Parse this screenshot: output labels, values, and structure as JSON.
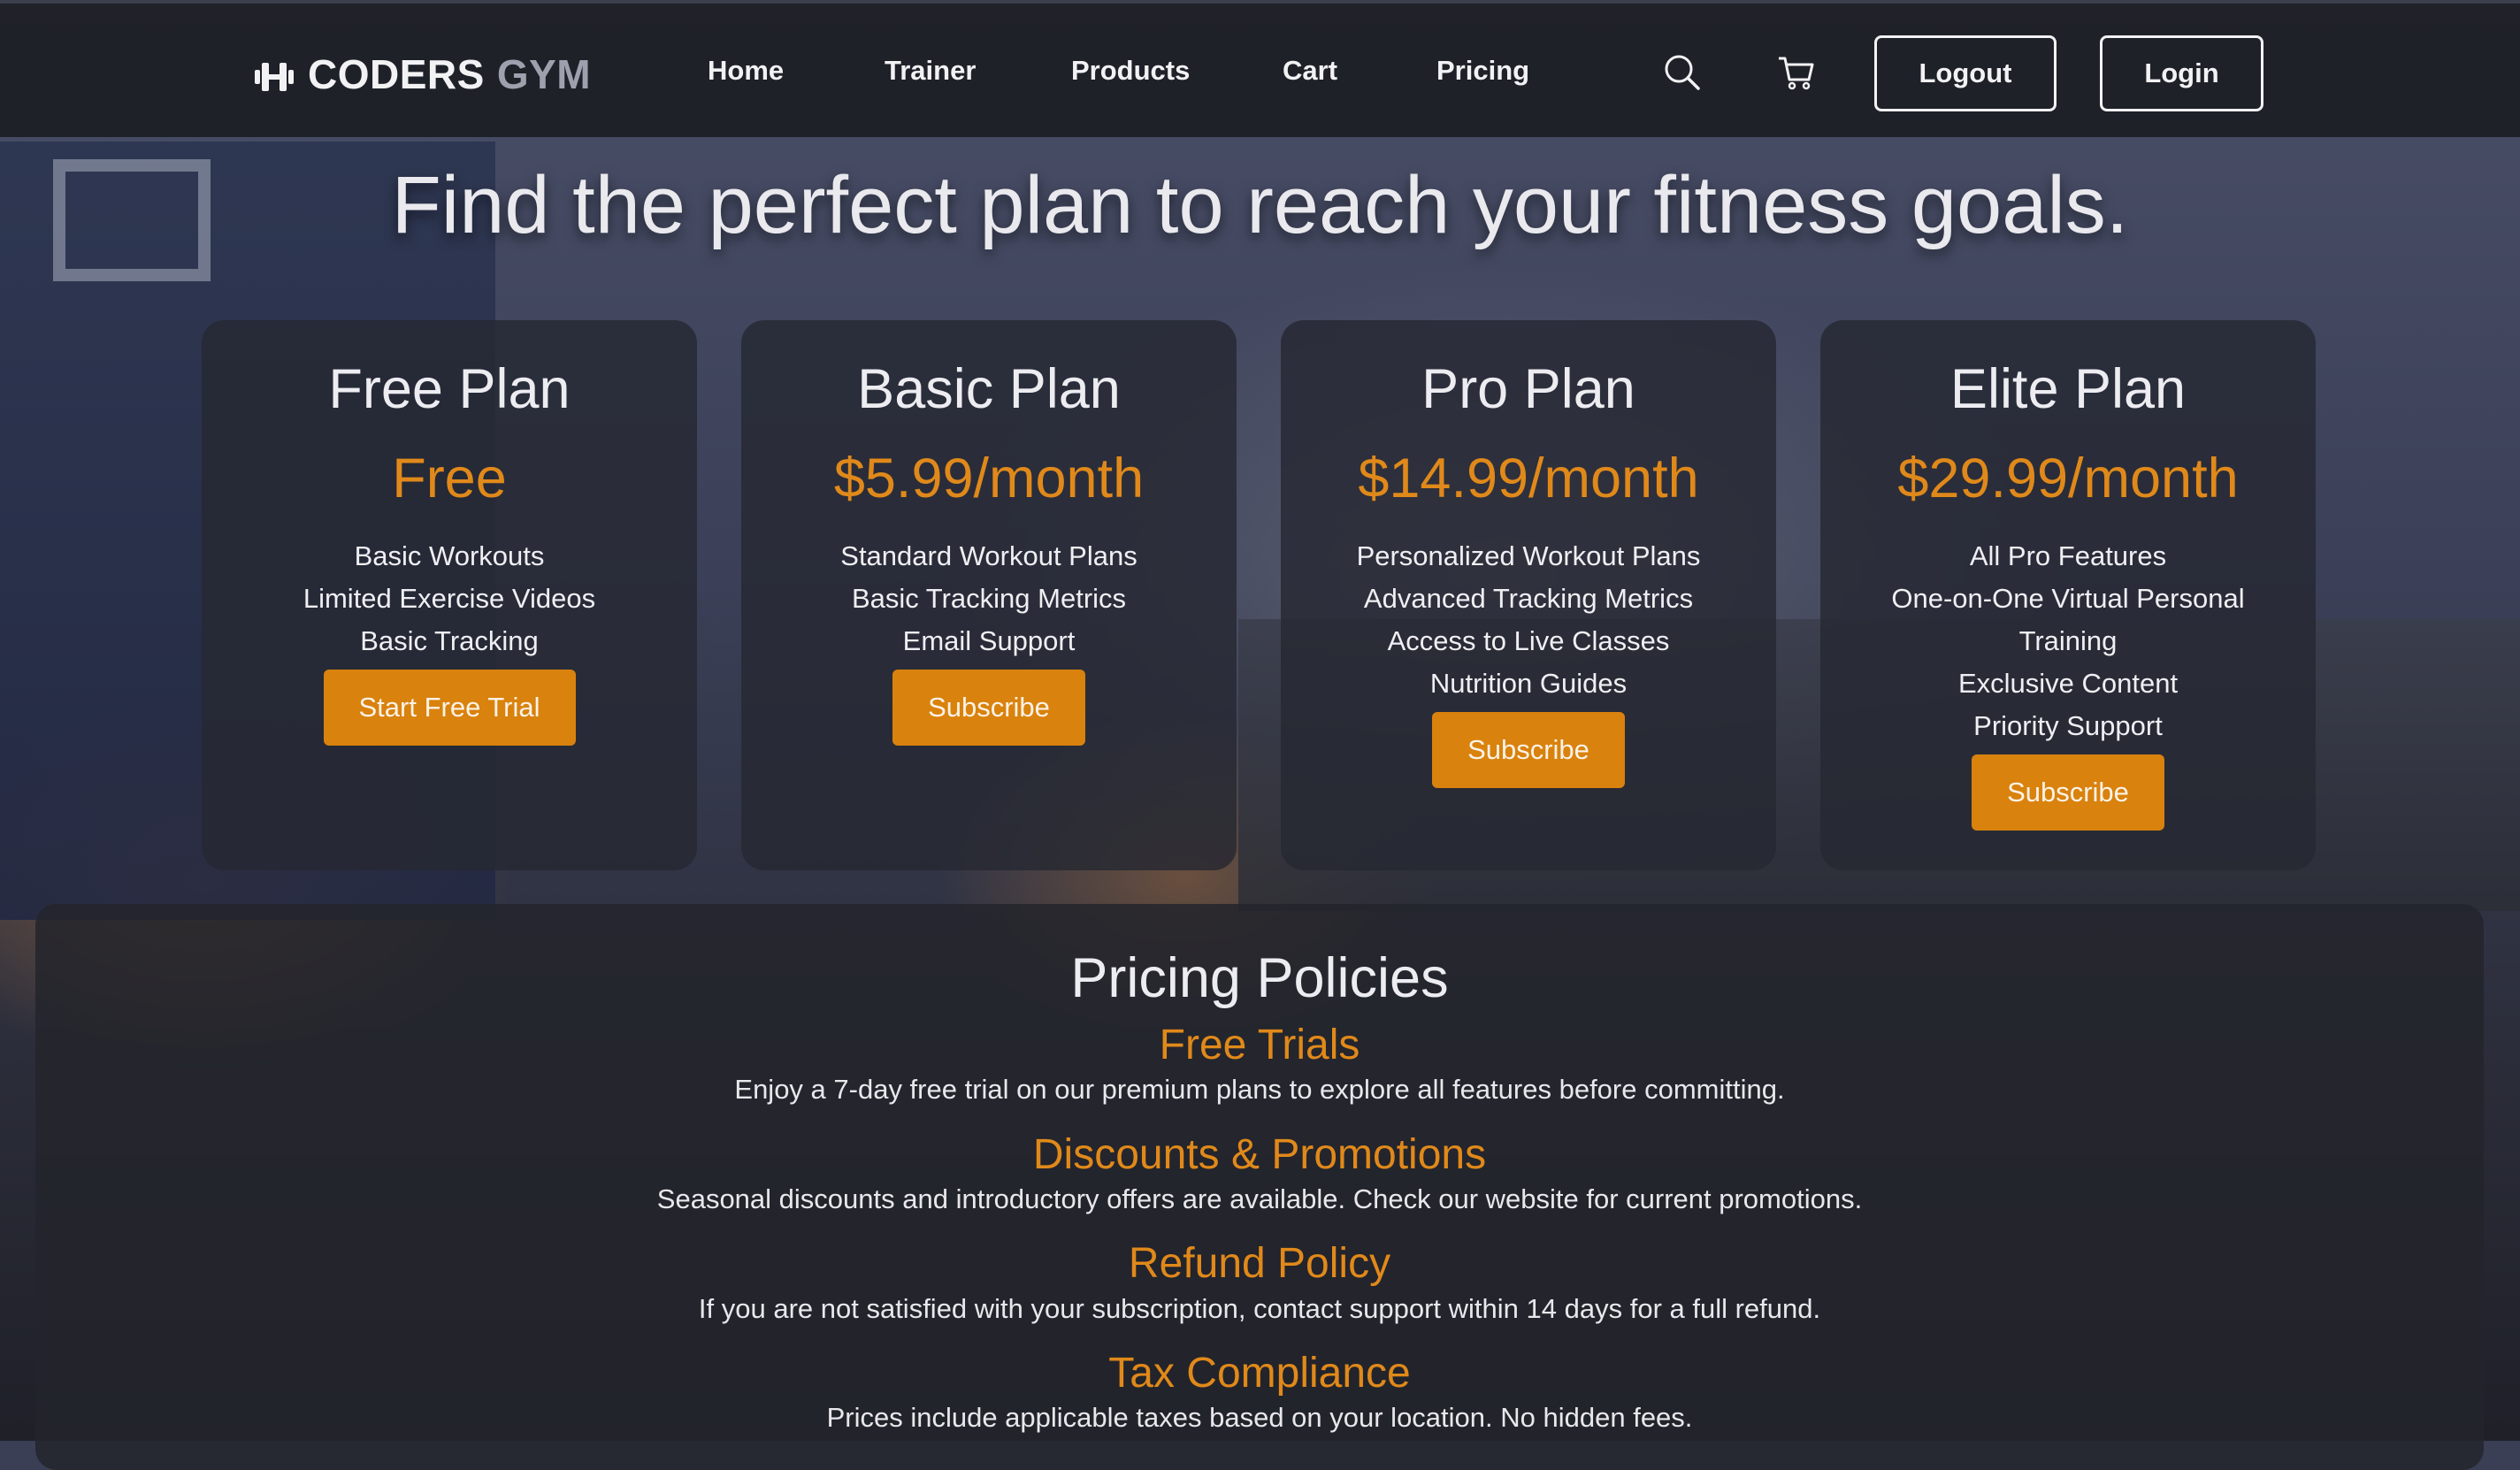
{
  "nav": {
    "logo_primary": "CODERS",
    "logo_secondary": "GYM",
    "links": [
      "Home",
      "Trainer",
      "Products",
      "Cart",
      "Pricing"
    ],
    "logout_label": "Logout",
    "login_label": "Login"
  },
  "hero": {
    "title": "Find the perfect plan to reach your fitness goals."
  },
  "plans": [
    {
      "name": "Free Plan",
      "price": "Free",
      "features": [
        "Basic Workouts",
        "Limited Exercise Videos",
        "Basic Tracking"
      ],
      "button": "Start Free Trial"
    },
    {
      "name": "Basic Plan",
      "price": "$5.99/month",
      "features": [
        "Standard Workout Plans",
        "Basic Tracking Metrics",
        "Email Support"
      ],
      "button": "Subscribe"
    },
    {
      "name": "Pro Plan",
      "price": "$14.99/month",
      "features": [
        "Personalized Workout Plans",
        "Advanced Tracking Metrics",
        "Access to Live Classes",
        "Nutrition Guides"
      ],
      "button": "Subscribe"
    },
    {
      "name": "Elite Plan",
      "price": "$29.99/month",
      "features": [
        "All Pro Features",
        "One-on-One Virtual Personal Training",
        "Exclusive Content",
        "Priority Support"
      ],
      "button": "Subscribe"
    }
  ],
  "policies": {
    "title": "Pricing Policies",
    "items": [
      {
        "heading": "Free Trials",
        "text": "Enjoy a 7-day free trial on our premium plans to explore all features before committing."
      },
      {
        "heading": "Discounts & Promotions",
        "text": "Seasonal discounts and introductory offers are available. Check our website for current promotions."
      },
      {
        "heading": "Refund Policy",
        "text": "If you are not satisfied with your subscription, contact support within 14 days for a full refund."
      },
      {
        "heading": "Tax Compliance",
        "text": "Prices include applicable taxes based on your location. No hidden fees."
      }
    ]
  },
  "colors": {
    "accent": "#d9820d",
    "price": "#e0891a",
    "navbar": "#1c1d24"
  },
  "icons": [
    "dumbbell-icon",
    "search-icon",
    "cart-icon"
  ]
}
